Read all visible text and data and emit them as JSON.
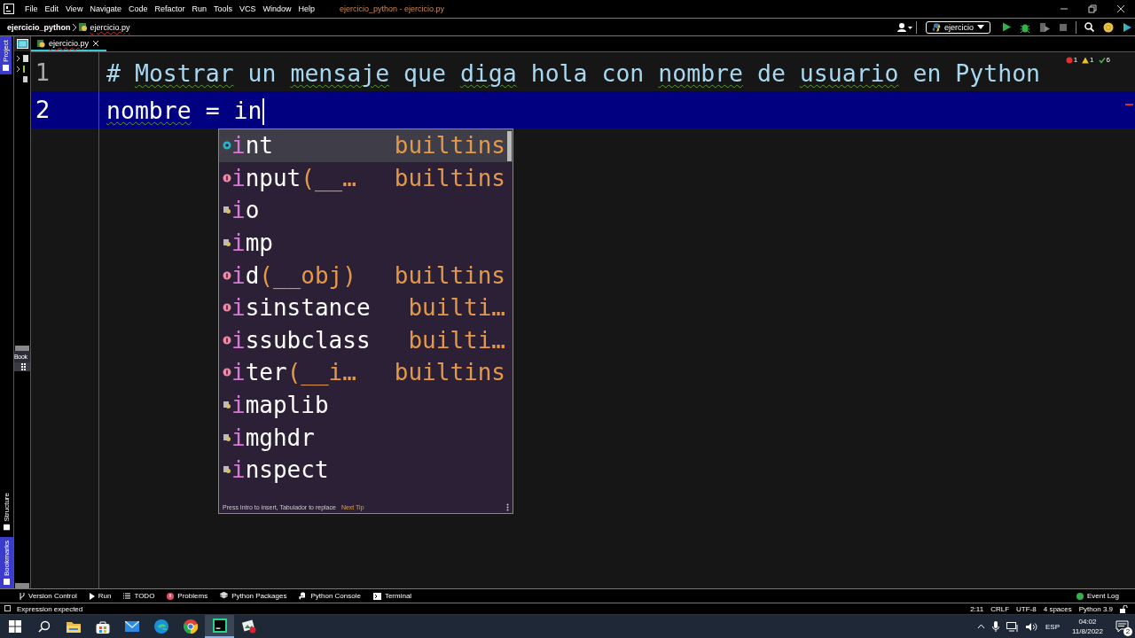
{
  "title_bar": {
    "menu": [
      "File",
      "Edit",
      "View",
      "Navigate",
      "Code",
      "Refactor",
      "Run",
      "Tools",
      "VCS",
      "Window",
      "Help"
    ],
    "title": "ejercicio_python - ejercicio.py"
  },
  "nav_bar": {
    "breadcrumbs": [
      "ejercicio_python",
      "ejercicio.py"
    ],
    "run_config": "ejercicio"
  },
  "left_strip": {
    "top_tabs": [
      {
        "label": "Project",
        "selected": true
      }
    ],
    "bottom_tabs": [
      {
        "label": "Structure",
        "selected": false
      },
      {
        "label": "Bookmarks",
        "selected": true
      }
    ]
  },
  "project_panel": {
    "bookmarks_header": "Book"
  },
  "editor_tabs": [
    {
      "label": "ejercicio.py",
      "selected": true
    }
  ],
  "editor": {
    "inspections": {
      "errors": "1",
      "warnings": "1",
      "ok": "6"
    },
    "lines": [
      {
        "number": "1",
        "kind": "comment",
        "current": false,
        "tokens": [
          {
            "text": "# ",
            "typo": false
          },
          {
            "text": "Mostrar",
            "typo": true
          },
          {
            "text": " un ",
            "typo": false
          },
          {
            "text": "mensaje",
            "typo": true
          },
          {
            "text": " que ",
            "typo": false
          },
          {
            "text": "diga",
            "typo": true
          },
          {
            "text": " hola con ",
            "typo": false
          },
          {
            "text": "nombre",
            "typo": true
          },
          {
            "text": " de ",
            "typo": false
          },
          {
            "text": "usuario",
            "typo": true
          },
          {
            "text": " en Python",
            "typo": false
          }
        ]
      },
      {
        "number": "2",
        "kind": "code",
        "current": true,
        "tokens": [
          {
            "text": "nombre",
            "typo": true
          },
          {
            "text": " = in",
            "typo": false
          }
        ]
      }
    ]
  },
  "completion": {
    "items": [
      {
        "kind": "class",
        "match": "i",
        "rest": "nt",
        "type": "builtins",
        "selected": true
      },
      {
        "kind": "function",
        "match": "i",
        "rest": "nput",
        "params": "(__…",
        "type": "builtins",
        "selected": false
      },
      {
        "kind": "module",
        "match": "i",
        "rest": "o",
        "selected": false
      },
      {
        "kind": "module",
        "match": "i",
        "rest": "mp",
        "selected": false
      },
      {
        "kind": "function",
        "match": "i",
        "rest": "d",
        "params": "(__obj)",
        "type": "builtins",
        "selected": false
      },
      {
        "kind": "function",
        "match": "i",
        "rest": "sinstance",
        "type": "builti…",
        "selected": false
      },
      {
        "kind": "function",
        "match": "i",
        "rest": "ssubclass",
        "type": "builti…",
        "selected": false
      },
      {
        "kind": "function",
        "match": "i",
        "rest": "ter",
        "params": "(__i…",
        "type": "builtins",
        "selected": false
      },
      {
        "kind": "module",
        "match": "i",
        "rest": "maplib",
        "selected": false
      },
      {
        "kind": "module",
        "match": "i",
        "rest": "mghdr",
        "selected": false
      },
      {
        "kind": "module",
        "match": "i",
        "rest": "nspect",
        "selected": false
      }
    ],
    "hint": "Press Intro to insert, Tabulador to replace",
    "link": "Next Tip"
  },
  "tool_windows": [
    {
      "kind": "vcs",
      "label": "Version Control"
    },
    {
      "kind": "run",
      "label": "Run"
    },
    {
      "kind": "todo",
      "label": "TODO"
    },
    {
      "kind": "problems",
      "label": "Problems"
    },
    {
      "kind": "packages",
      "label": "Python Packages"
    },
    {
      "kind": "console",
      "label": "Python Console"
    },
    {
      "kind": "terminal",
      "label": "Terminal"
    }
  ],
  "event_log": "Event Log",
  "status_bar": {
    "message": "Expression expected",
    "items": [
      "2:11",
      "CRLF",
      "UTF-8",
      "4 spaces",
      "Python 3.9"
    ]
  },
  "taskbar": {
    "apps": [
      {
        "kind": "start",
        "selected": false
      },
      {
        "kind": "search",
        "selected": false
      },
      {
        "kind": "explorer",
        "selected": false
      },
      {
        "kind": "store",
        "selected": false
      },
      {
        "kind": "mail",
        "selected": false
      },
      {
        "kind": "edge",
        "selected": false
      },
      {
        "kind": "chrome",
        "selected": false
      },
      {
        "kind": "pycharm",
        "selected": true
      },
      {
        "kind": "photos",
        "selected": false
      }
    ],
    "language": "ESP",
    "time": "04:02",
    "date": "11/8/2022",
    "notifications": "2"
  }
}
